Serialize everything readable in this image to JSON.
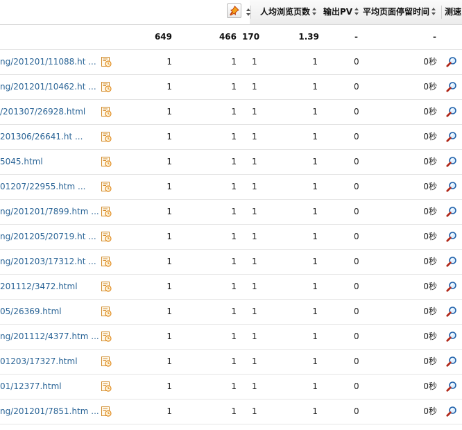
{
  "header": {
    "pin_icon": "pin-icon",
    "columns": {
      "avg_pages": "人均浏览页数",
      "output_pv": "输出PV",
      "avg_stay": "平均页面停留时间",
      "speed_test": "测速"
    }
  },
  "summary": {
    "c1": "649",
    "c2": "466",
    "c3": "170",
    "c4": "1.39",
    "c5": "-",
    "c6": "-"
  },
  "rows": [
    {
      "url": "ng/201201/11088.ht ...",
      "c1": "1",
      "c2": "1",
      "c3": "1",
      "c4": "1",
      "c5": "0",
      "c6": "0秒"
    },
    {
      "url": "ng/201201/10462.ht ...",
      "c1": "1",
      "c2": "1",
      "c3": "1",
      "c4": "1",
      "c5": "0",
      "c6": "0秒"
    },
    {
      "url": "/201307/26928.html",
      "c1": "1",
      "c2": "1",
      "c3": "1",
      "c4": "1",
      "c5": "0",
      "c6": "0秒"
    },
    {
      "url": "201306/26641.ht ...",
      "c1": "1",
      "c2": "1",
      "c3": "1",
      "c4": "1",
      "c5": "0",
      "c6": "0秒"
    },
    {
      "url": "5045.html",
      "c1": "1",
      "c2": "1",
      "c3": "1",
      "c4": "1",
      "c5": "0",
      "c6": "0秒"
    },
    {
      "url": "01207/22955.htm ...",
      "c1": "1",
      "c2": "1",
      "c3": "1",
      "c4": "1",
      "c5": "0",
      "c6": "0秒"
    },
    {
      "url": "ng/201201/7899.htm ...",
      "c1": "1",
      "c2": "1",
      "c3": "1",
      "c4": "1",
      "c5": "0",
      "c6": "0秒"
    },
    {
      "url": "ng/201205/20719.ht ...",
      "c1": "1",
      "c2": "1",
      "c3": "1",
      "c4": "1",
      "c5": "0",
      "c6": "0秒"
    },
    {
      "url": "ng/201203/17312.ht ...",
      "c1": "1",
      "c2": "1",
      "c3": "1",
      "c4": "1",
      "c5": "0",
      "c6": "0秒"
    },
    {
      "url": "201112/3472.html",
      "c1": "1",
      "c2": "1",
      "c3": "1",
      "c4": "1",
      "c5": "0",
      "c6": "0秒"
    },
    {
      "url": "05/26369.html",
      "c1": "1",
      "c2": "1",
      "c3": "1",
      "c4": "1",
      "c5": "0",
      "c6": "0秒"
    },
    {
      "url": "ng/201112/4377.htm ...",
      "c1": "1",
      "c2": "1",
      "c3": "1",
      "c4": "1",
      "c5": "0",
      "c6": "0秒"
    },
    {
      "url": "01203/17327.html",
      "c1": "1",
      "c2": "1",
      "c3": "1",
      "c4": "1",
      "c5": "0",
      "c6": "0秒"
    },
    {
      "url": "01/12377.html",
      "c1": "1",
      "c2": "1",
      "c3": "1",
      "c4": "1",
      "c5": "0",
      "c6": "0秒"
    },
    {
      "url": "ng/201201/7851.htm ...",
      "c1": "1",
      "c2": "1",
      "c3": "1",
      "c4": "1",
      "c5": "0",
      "c6": "0秒"
    }
  ],
  "icons": {
    "history": "history-icon",
    "speed": "speed-test-icon"
  },
  "colors": {
    "link": "#2a6496",
    "header_bg": "#ececec",
    "icon_orange": "#e08a1e"
  }
}
